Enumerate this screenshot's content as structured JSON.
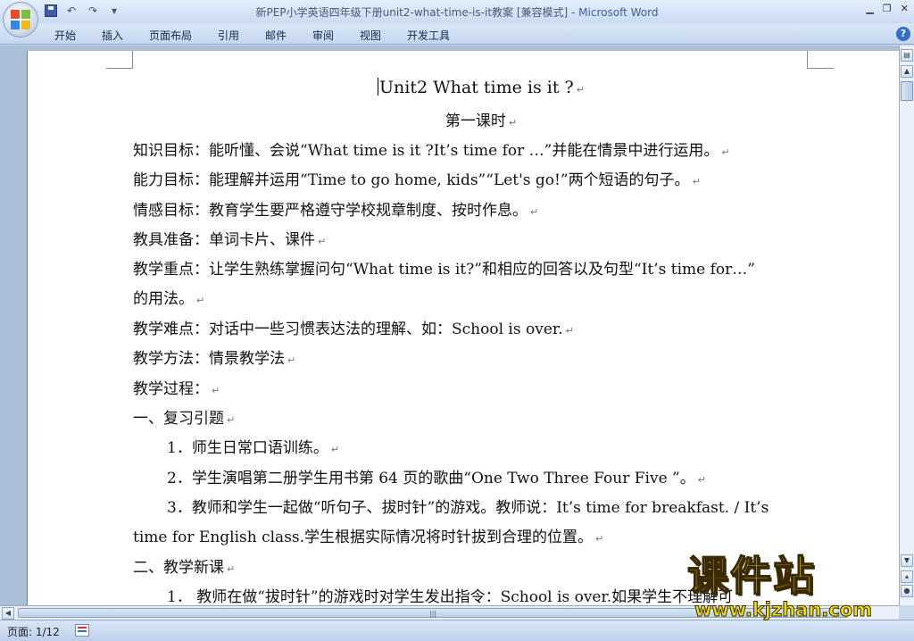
{
  "window": {
    "title_doc": "新PEP小学英语四年级下册unit2-what-time-is-it教案 [兼容模式] - ",
    "title_app": "Microsoft Word",
    "controls": [
      "▁",
      "❐",
      "✕"
    ]
  },
  "quick_access": {
    "save_icon": "save-icon",
    "undo": "↶",
    "redo": "↷",
    "customize": "▾"
  },
  "ribbon": {
    "tabs": [
      "开始",
      "插入",
      "页面布局",
      "引用",
      "邮件",
      "审阅",
      "视图",
      "开发工具"
    ],
    "help": "?"
  },
  "document": {
    "title": "Unit2 What time is it ?",
    "subtitle": "第一课时",
    "lines": [
      "知识目标：能听懂、会说“What time is it ?It’s time for …”并能在情景中进行运用。",
      "能力目标：能理解并运用“Time to go home, kids”“Let's go!”两个短语的句子。",
      "情感目标：教育学生要严格遵守学校规章制度、按时作息。",
      "教具准备：单词卡片、课件",
      "教学重点：让学生熟练掌握问句“What time is it?”和相应的回答以及句型“It’s time for…”",
      "的用法。",
      "教学难点：对话中一些习惯表达法的理解、如：School is over.",
      "教学方法：情景教学法",
      "教学过程：",
      "一、复习引题",
      "1．师生日常口语训练。",
      "2．学生演唱第二册学生用书第 64 页的歌曲“One Two Three Four Five ”。",
      "3．教师和学生一起做“听句子、拔时针”的游戏。教师说：It’s time for breakfast. / It’s",
      "time for English class.学生根据实际情况将时针拔到合理的位置。",
      "二、教学新课",
      "1．  教师在做“拔时针”的游戏时对学生发出指令：School is over.如果学生不理解可"
    ],
    "paragraph_mark": "↵"
  },
  "statusbar": {
    "page": "页面: 1/12"
  },
  "watermark": {
    "text": "课件站",
    "url": "www.kjzhan.com"
  }
}
